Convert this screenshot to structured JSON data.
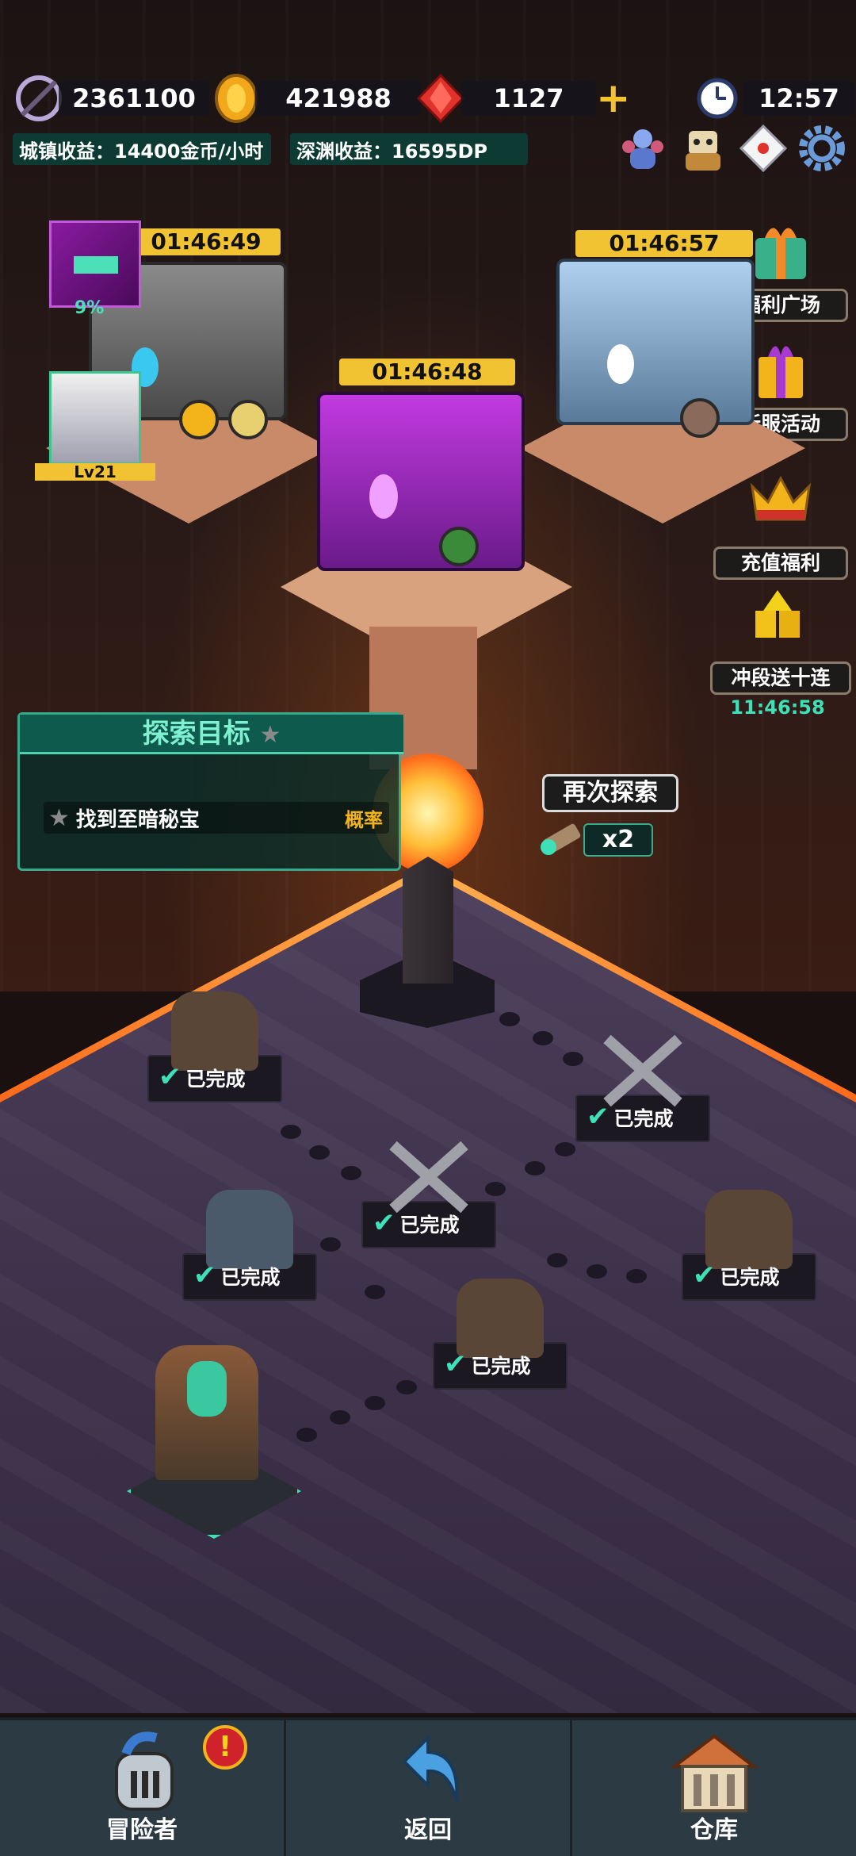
{
  "resources": {
    "power": "2361100",
    "gold": "421988",
    "gems": "1127",
    "clock": "12:57",
    "plus": "+"
  },
  "income": {
    "town": "城镇收益：14400金币/小时",
    "abyss": "深渊收益：16595DP"
  },
  "top_icons": [
    "team-icon",
    "character-icon",
    "mail-icon",
    "settings-icon"
  ],
  "side_menu": [
    {
      "label": "福利广场",
      "icon": "gift-box-icon"
    },
    {
      "label": "新服活动",
      "icon": "present-icon"
    },
    {
      "label": "充值福利",
      "icon": "crown-icon"
    },
    {
      "label": "冲段送十连",
      "icon": "gold-bars-icon",
      "timer": "11:46:58"
    }
  ],
  "chests": [
    {
      "timer": "01:46:49",
      "progress": "9%",
      "level": "Lv21"
    },
    {
      "timer": "01:46:48"
    },
    {
      "timer": "01:46:57"
    }
  ],
  "target": {
    "title": "探索目标",
    "goal": "找到至暗秘宝",
    "rate": "概率"
  },
  "explore": {
    "button": "再次探索",
    "count": "x2"
  },
  "nodes": {
    "done_label": "已完成"
  },
  "nav": {
    "adventurer": "冒险者",
    "back": "返回",
    "warehouse": "仓库",
    "alert": "!"
  },
  "colors": {
    "accent_teal": "#3ee0b8",
    "timer_yellow": "#f1c232",
    "lava_orange": "#ff6a1a"
  }
}
